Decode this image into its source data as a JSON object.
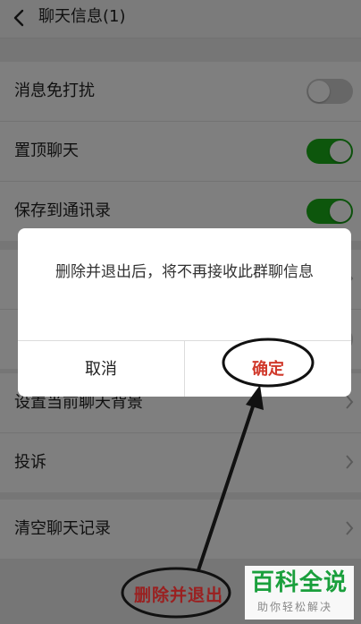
{
  "header": {
    "title": "聊天信息(1)"
  },
  "settings": {
    "group1": [
      {
        "label": "消息免打扰",
        "toggle": "off"
      },
      {
        "label": "置顶聊天",
        "toggle": "on"
      },
      {
        "label": "保存到通讯录",
        "toggle": "on"
      }
    ],
    "group2": [
      {
        "label": ""
      },
      {
        "label": ""
      }
    ],
    "group3": [
      {
        "label": "设置当前聊天背景"
      },
      {
        "label": "投诉"
      }
    ],
    "group4": [
      {
        "label": "清空聊天记录"
      }
    ]
  },
  "dialog": {
    "message": "删除并退出后，将不再接收此群聊信息",
    "cancel_label": "取消",
    "confirm_label": "确定"
  },
  "bottom": {
    "delete_exit_label": "删除并退出"
  },
  "watermark": {
    "title": "百科全说",
    "subtitle": "助你轻松解决"
  },
  "colors": {
    "toggle_on": "#1aad19",
    "toggle_off": "#cfcfcf",
    "confirm": "#d0392b",
    "watermark": "#1a9f3c"
  }
}
